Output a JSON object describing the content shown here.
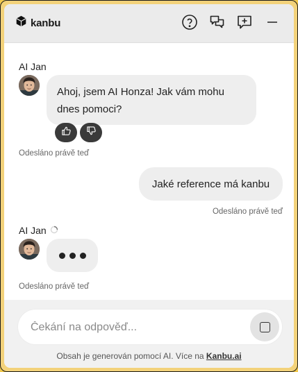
{
  "header": {
    "logo_text": "kanbu",
    "icons": [
      "help-icon",
      "chat-history-icon",
      "new-chat-icon",
      "minimize-icon"
    ]
  },
  "messages": [
    {
      "sender": "AI Jan",
      "text_line1": "Ahoj, jsem AI Honza! Jak vám mohu",
      "text_line2": "dnes pomoci?",
      "meta": "Odesláno právě teď"
    },
    {
      "text": "Jaké reference má kanbu",
      "meta": "Odesláno právě teď"
    },
    {
      "sender": "AI Jan",
      "typing": true,
      "meta": "Odesláno právě teď"
    }
  ],
  "composer": {
    "placeholder": "Čekání na odpověď..."
  },
  "footer": {
    "disclaimer_text": "Obsah je generován pomocí AI. Více na",
    "link_text": "Kanbu.ai"
  },
  "colors": {
    "frame_background": "#f3d27a",
    "header_background": "#ebebeb",
    "bubble_background": "#eeeeee",
    "feedback_button": "#3a3a3a"
  }
}
